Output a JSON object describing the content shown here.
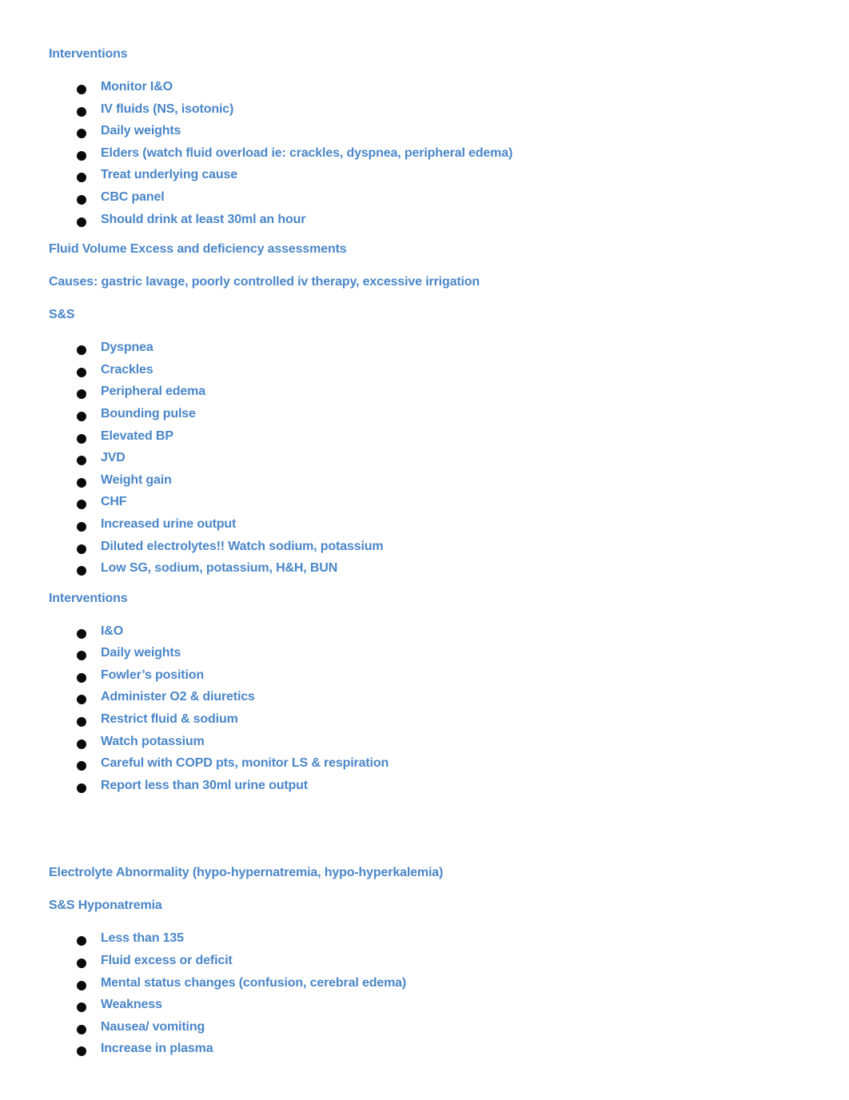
{
  "document": {
    "text_color": "#4a86c8",
    "bullet_color": "#0a0a0a",
    "background_color": "#ffffff",
    "sections": [
      {
        "heading": "Interventions",
        "items": [
          "Monitor I&O",
          "IV fluids (NS, isotonic)",
          "Daily weights",
          "Elders (watch fluid overload ie: crackles, dyspnea, peripheral edema)",
          "Treat underlying cause",
          "CBC panel",
          "Should drink at least 30ml an hour"
        ]
      },
      {
        "heading": "Fluid Volume Excess and deficiency assessments",
        "paragraphs": [
          "Causes: gastric lavage, poorly controlled iv therapy, excessive irrigation"
        ],
        "subheading": "S&S",
        "items": [
          "Dyspnea",
          "Crackles",
          "Peripheral edema",
          "Bounding pulse",
          "Elevated BP",
          "JVD",
          "Weight gain",
          "CHF",
          "Increased urine output",
          "Diluted electrolytes!! Watch sodium, potassium",
          "Low SG, sodium, potassium, H&H, BUN"
        ]
      },
      {
        "heading": "Interventions",
        "items": [
          "I&O",
          "Daily weights",
          "Fowler’s position",
          "Administer O2 & diuretics",
          "Restrict fluid & sodium",
          "Watch potassium",
          "Careful with COPD pts, monitor LS & respiration",
          "Report less than 30ml urine output"
        ]
      },
      {
        "heading": "Electrolyte Abnormality (hypo-hypernatremia, hypo-hyperkalemia)",
        "subheading": "S&S Hyponatremia",
        "items": [
          "Less than 135",
          "Fluid excess or deficit",
          "Mental status changes (confusion, cerebral edema)",
          "Weakness",
          "Nausea/ vomiting",
          "Increase in plasma"
        ]
      }
    ]
  }
}
